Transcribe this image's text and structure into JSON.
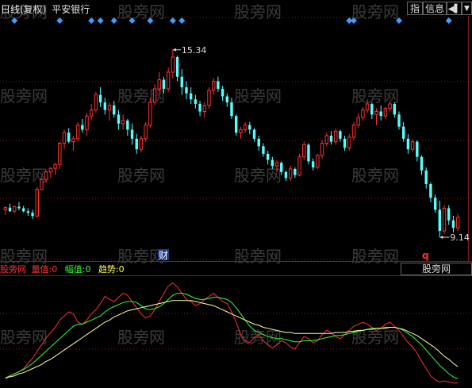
{
  "header": {
    "title": "日线(复权)",
    "stock": "平安银行",
    "btn_index": "指",
    "btn_info": "信息",
    "btn_arrow": "◀▌",
    "btn_down": "▼"
  },
  "watermark": "股旁网",
  "indicator": {
    "name": "股旁网",
    "items": [
      {
        "label": "量值:",
        "value": "0",
        "color": "#ff3030"
      },
      {
        "label": "幅值:",
        "value": "0",
        "color": "#30ff30"
      },
      {
        "label": "趋势:",
        "value": "0",
        "color": "#ffff40"
      }
    ],
    "tab": "股旁网"
  },
  "markers": {
    "cai": "财",
    "q": "q"
  },
  "chart_data": [
    {
      "type": "candlestick",
      "title": "平安银行",
      "ylim": [
        8.8,
        16.2
      ],
      "high_label": "15.34",
      "low_label": "9.14",
      "candles": [
        [
          10.05,
          10.15,
          9.88,
          10.12
        ],
        [
          10.12,
          10.25,
          9.98,
          10.0
        ],
        [
          10.0,
          10.18,
          9.95,
          10.15
        ],
        [
          10.15,
          10.3,
          10.03,
          10.1
        ],
        [
          10.1,
          10.18,
          9.96,
          10.0
        ],
        [
          10.0,
          10.1,
          9.85,
          9.95
        ],
        [
          9.95,
          10.05,
          9.75,
          9.84
        ],
        [
          9.84,
          10.8,
          9.8,
          10.72
        ],
        [
          10.72,
          11.1,
          10.7,
          11.05
        ],
        [
          11.05,
          11.35,
          10.95,
          11.3
        ],
        [
          11.3,
          11.45,
          11.1,
          11.42
        ],
        [
          11.42,
          11.6,
          11.2,
          11.55
        ],
        [
          11.55,
          12.3,
          11.4,
          12.25
        ],
        [
          12.25,
          12.7,
          12.05,
          12.6
        ],
        [
          12.6,
          12.75,
          12.25,
          12.3
        ],
        [
          12.3,
          12.5,
          12.0,
          12.4
        ],
        [
          12.4,
          12.95,
          12.3,
          12.85
        ],
        [
          12.85,
          13.05,
          12.6,
          12.7
        ],
        [
          12.7,
          13.25,
          12.5,
          13.15
        ],
        [
          13.15,
          13.55,
          13.0,
          13.35
        ],
        [
          13.35,
          13.95,
          13.25,
          13.85
        ],
        [
          13.85,
          14.1,
          13.45,
          13.6
        ],
        [
          13.6,
          13.75,
          13.2,
          13.35
        ],
        [
          13.35,
          13.6,
          13.0,
          13.5
        ],
        [
          13.5,
          13.65,
          13.1,
          13.2
        ],
        [
          13.2,
          13.35,
          12.7,
          12.9
        ],
        [
          12.9,
          13.2,
          12.7,
          13.0
        ],
        [
          13.0,
          13.05,
          12.5,
          12.7
        ],
        [
          12.7,
          12.9,
          12.2,
          12.4
        ],
        [
          12.4,
          12.55,
          11.9,
          12.05
        ],
        [
          12.05,
          12.5,
          11.95,
          12.4
        ],
        [
          12.4,
          12.95,
          12.3,
          12.85
        ],
        [
          12.85,
          13.75,
          12.75,
          13.6
        ],
        [
          13.6,
          14.2,
          13.5,
          14.05
        ],
        [
          14.05,
          14.6,
          13.9,
          14.35
        ],
        [
          14.35,
          14.45,
          13.9,
          14.05
        ],
        [
          14.05,
          14.75,
          13.95,
          14.6
        ],
        [
          14.6,
          15.34,
          14.4,
          15.1
        ],
        [
          15.1,
          15.15,
          14.3,
          14.45
        ],
        [
          14.45,
          14.7,
          13.85,
          14.1
        ],
        [
          14.1,
          14.3,
          13.7,
          13.9
        ],
        [
          13.9,
          14.1,
          13.55,
          13.7
        ],
        [
          13.7,
          13.85,
          13.4,
          13.55
        ],
        [
          13.55,
          13.65,
          13.15,
          13.3
        ],
        [
          13.3,
          13.6,
          13.1,
          13.5
        ],
        [
          13.5,
          14.1,
          13.4,
          14.0
        ],
        [
          14.0,
          14.4,
          13.85,
          14.3
        ],
        [
          14.3,
          14.45,
          13.95,
          14.05
        ],
        [
          14.05,
          14.15,
          13.65,
          13.8
        ],
        [
          13.8,
          13.9,
          13.45,
          13.6
        ],
        [
          13.6,
          13.75,
          13.05,
          13.15
        ],
        [
          13.15,
          13.2,
          12.5,
          12.6
        ],
        [
          12.6,
          12.8,
          12.4,
          12.7
        ],
        [
          12.7,
          12.95,
          12.6,
          12.85
        ],
        [
          12.85,
          12.95,
          12.55,
          12.7
        ],
        [
          12.7,
          12.75,
          12.3,
          12.4
        ],
        [
          12.4,
          12.5,
          12.0,
          12.15
        ],
        [
          12.15,
          12.25,
          11.8,
          11.9
        ],
        [
          11.9,
          12.0,
          11.55,
          11.7
        ],
        [
          11.7,
          11.8,
          11.4,
          11.5
        ],
        [
          11.5,
          11.7,
          11.3,
          11.6
        ],
        [
          11.6,
          11.65,
          11.2,
          11.3
        ],
        [
          11.3,
          11.35,
          11.0,
          11.1
        ],
        [
          11.1,
          11.5,
          11.0,
          11.4
        ],
        [
          11.4,
          11.45,
          11.1,
          11.2
        ],
        [
          11.2,
          11.9,
          11.15,
          11.8
        ],
        [
          11.8,
          12.3,
          11.7,
          12.2
        ],
        [
          12.2,
          12.25,
          11.55,
          11.65
        ],
        [
          11.65,
          11.75,
          11.35,
          11.45
        ],
        [
          11.45,
          11.9,
          11.4,
          11.85
        ],
        [
          11.85,
          12.35,
          11.75,
          12.25
        ],
        [
          12.25,
          12.6,
          12.15,
          12.5
        ],
        [
          12.5,
          12.65,
          12.2,
          12.3
        ],
        [
          12.3,
          12.75,
          12.2,
          12.65
        ],
        [
          12.65,
          12.7,
          12.3,
          12.4
        ],
        [
          12.4,
          12.5,
          12.0,
          12.1
        ],
        [
          12.1,
          12.55,
          12.0,
          12.45
        ],
        [
          12.45,
          12.95,
          12.35,
          12.85
        ],
        [
          12.85,
          13.25,
          12.75,
          13.1
        ],
        [
          13.1,
          13.45,
          13.0,
          13.35
        ],
        [
          13.35,
          13.7,
          13.25,
          13.55
        ],
        [
          13.55,
          13.6,
          13.05,
          13.2
        ],
        [
          13.2,
          13.4,
          12.85,
          13.3
        ],
        [
          13.3,
          13.5,
          13.0,
          13.15
        ],
        [
          13.15,
          13.45,
          13.05,
          13.4
        ],
        [
          13.4,
          13.65,
          13.3,
          13.55
        ],
        [
          13.55,
          13.6,
          13.1,
          13.2
        ],
        [
          13.2,
          13.3,
          12.7,
          12.8
        ],
        [
          12.8,
          12.95,
          12.3,
          12.4
        ],
        [
          12.4,
          12.55,
          11.9,
          12.05
        ],
        [
          12.05,
          12.4,
          11.95,
          12.3
        ],
        [
          12.3,
          12.35,
          11.65,
          11.8
        ],
        [
          11.8,
          11.85,
          11.2,
          11.35
        ],
        [
          11.35,
          11.45,
          10.75,
          10.9
        ],
        [
          10.9,
          10.95,
          10.3,
          10.45
        ],
        [
          10.45,
          10.55,
          9.95,
          10.05
        ],
        [
          10.05,
          10.35,
          9.14,
          9.35
        ],
        [
          9.35,
          10.2,
          9.25,
          10.1
        ],
        [
          10.1,
          10.2,
          9.55,
          9.7
        ],
        [
          9.7,
          9.85,
          9.3,
          9.45
        ],
        [
          9.45,
          9.9,
          9.35,
          9.8
        ]
      ],
      "signals_top": [
        2,
        12,
        19,
        21,
        24,
        28,
        32,
        37,
        39,
        76,
        77,
        87,
        98
      ]
    },
    {
      "type": "line",
      "title": "股旁网",
      "ylim": [
        0,
        100
      ],
      "series": [
        {
          "name": "量值",
          "color": "#ff3030",
          "values": [
            5,
            8,
            10,
            12,
            15,
            20,
            25,
            32,
            38,
            45,
            50,
            55,
            62,
            66,
            70,
            68,
            60,
            58,
            62,
            68,
            72,
            78,
            85,
            82,
            80,
            84,
            88,
            86,
            80,
            74,
            68,
            64,
            66,
            72,
            80,
            88,
            95,
            98,
            94,
            88,
            82,
            80,
            76,
            78,
            82,
            85,
            88,
            84,
            80,
            78,
            70,
            60,
            48,
            42,
            40,
            45,
            48,
            42,
            38,
            35,
            38,
            42,
            40,
            36,
            34,
            40,
            46,
            44,
            40,
            42,
            48,
            52,
            50,
            46,
            44,
            48,
            52,
            56,
            58,
            60,
            58,
            55,
            52,
            54,
            58,
            60,
            56,
            52,
            46,
            40,
            36,
            30,
            22,
            15,
            8,
            4,
            2,
            3,
            2,
            1,
            1
          ]
        },
        {
          "name": "幅值",
          "color": "#30ff30",
          "values": [
            6,
            8,
            10,
            12,
            14,
            17,
            20,
            24,
            28,
            32,
            36,
            40,
            44,
            48,
            52,
            56,
            58,
            58,
            60,
            62,
            64,
            66,
            70,
            73,
            75,
            77,
            79,
            80,
            80,
            79,
            76,
            73,
            72,
            73,
            75,
            78,
            82,
            86,
            88,
            88,
            87,
            85,
            83,
            82,
            82,
            83,
            84,
            84,
            83,
            82,
            79,
            74,
            68,
            62,
            56,
            52,
            50,
            48,
            46,
            45,
            44,
            44,
            43,
            42,
            41,
            41,
            42,
            42,
            42,
            43,
            44,
            45,
            46,
            47,
            47,
            48,
            49,
            50,
            51,
            52,
            53,
            54,
            54,
            54,
            55,
            55,
            55,
            54,
            52,
            49,
            46,
            42,
            38,
            33,
            28,
            23,
            18,
            14,
            10,
            7,
            5
          ]
        },
        {
          "name": "趋势",
          "color": "#ffffa0",
          "values": [
            6,
            7,
            8,
            10,
            11,
            13,
            15,
            17,
            19,
            22,
            24,
            27,
            30,
            33,
            36,
            39,
            42,
            45,
            48,
            51,
            54,
            57,
            60,
            62,
            65,
            67,
            69,
            71,
            72,
            73,
            74,
            75,
            76,
            77,
            78,
            79,
            80,
            81,
            81,
            81,
            81,
            81,
            80,
            79,
            78,
            77,
            76,
            74,
            72,
            70,
            68,
            66,
            64,
            62,
            60,
            58,
            57,
            55,
            54,
            53,
            52,
            51,
            50,
            50,
            49,
            49,
            49,
            49,
            49,
            49,
            49,
            49,
            49,
            50,
            50,
            50,
            51,
            51,
            52,
            52,
            53,
            53,
            54,
            54,
            54,
            55,
            55,
            54,
            53,
            51,
            49,
            47,
            44,
            41,
            38,
            35,
            31,
            27,
            24,
            20,
            17
          ]
        }
      ]
    }
  ]
}
